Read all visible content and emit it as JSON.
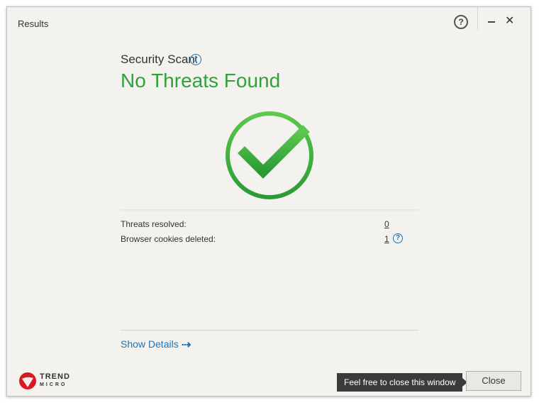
{
  "window": {
    "title": "Results"
  },
  "titlebar": {
    "help_glyph": "?",
    "close_glyph": "✕"
  },
  "scan": {
    "label": "Security Scan:",
    "result": "No Threats Found"
  },
  "stats": [
    {
      "label": "Threats resolved:",
      "value": "0"
    },
    {
      "label": "Browser cookies deleted:",
      "value": "1"
    }
  ],
  "details": {
    "link_label": "Show Details"
  },
  "brand": {
    "line1": "TREND",
    "line2": "MICRO"
  },
  "footer": {
    "tooltip": "Feel free to close this window",
    "close_label": "Close"
  },
  "colors": {
    "success": "#2fa33a",
    "link": "#1a73b8",
    "brand_red": "#d71920"
  }
}
